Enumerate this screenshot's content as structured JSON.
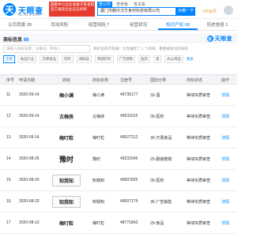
{
  "header": {
    "logo_mark": "天",
    "logo_text": "天眼查",
    "logo_url": "TianYanCha.com",
    "promo": [
      "国家中小企业发展子基金旗下",
      "官方备案企业征信机构"
    ],
    "search_tabs": [
      {
        "label": "查公司",
        "active": true
      },
      {
        "label": "查老板",
        "active": false
      },
      {
        "label": "查关系",
        "active": false
      }
    ],
    "search_value": "厦门市鹏仔汉方食材科技有限公司",
    "search_button": "天眼一下",
    "vip_label": "VIP会员"
  },
  "nav": [
    {
      "label": "公司背景",
      "count": "28",
      "active": false
    },
    {
      "label": "司法风险",
      "count": "",
      "active": false
    },
    {
      "label": "经营风险",
      "count": "7",
      "active": false
    },
    {
      "label": "经营状况",
      "count": "",
      "active": false
    },
    {
      "label": "知识产权",
      "count": "68",
      "active": true
    },
    {
      "label": "历史信息",
      "count": "1",
      "active": false
    }
  ],
  "section": {
    "title": "商标信息",
    "count": "68",
    "watermark": "天眼查"
  },
  "filter": {
    "placeholder": "请输入商标名称、注册号、申请人",
    "hint": "保护品牌不再难！为你推荐了 1 个商标，看看被抢注的商标"
  },
  "chips": [
    {
      "label": "全部",
      "active": true
    },
    {
      "label": "食品行业",
      "active": false
    },
    {
      "label": "方便食品",
      "active": false
    },
    {
      "label": "饮料",
      "active": false
    },
    {
      "label": "调味品",
      "active": false
    },
    {
      "label": "啤酒饮料",
      "active": false
    },
    {
      "label": "广告销售",
      "active": false
    },
    {
      "label": "医药",
      "active": false
    },
    {
      "label": "酒",
      "active": false
    },
    {
      "label": "办公用品",
      "active": false
    }
  ],
  "chip_link": "更多",
  "table": {
    "headers": [
      "序号",
      "申请日期",
      "商标",
      "商标名称",
      "注册号",
      "国际分类",
      "商标状态",
      "操作"
    ],
    "rows": [
      {
        "idx": "11",
        "date": "2020-09-14",
        "mark": "梅小满",
        "name": "梅小满",
        "reg": "49735177",
        "cls": "33-酒",
        "status": "等待实质审查",
        "op": "详情",
        "style": "plain"
      },
      {
        "idx": "12",
        "date": "2020-09-14",
        "mark": "古梅侠",
        "name": "古梅侠",
        "reg": "49633315",
        "cls": "05-医药",
        "status": "等待实质审查",
        "op": "详情",
        "style": "plain"
      },
      {
        "idx": "13",
        "date": "2020-09-14",
        "mark": "梅叮粒",
        "name": "梅叮粒",
        "reg": "49527212",
        "cls": "30-方便食品",
        "status": "等待实质审查",
        "op": "详情",
        "style": "plain"
      },
      {
        "idx": "14",
        "date": "2020-08-26",
        "mark": "豫时",
        "name": "豫时",
        "reg": "49231545",
        "cls": "25-服装鞋帽",
        "status": "等待实质审查",
        "op": "详情",
        "style": "big"
      },
      {
        "idx": "15",
        "date": "2020-08-20",
        "mark": "知我知",
        "name": "知我知",
        "reg": "49007835",
        "cls": "05-医药",
        "status": "等待实质审查",
        "op": "详情",
        "style": "boxed"
      },
      {
        "idx": "16",
        "date": "2020-08-20",
        "mark": "知我知",
        "name": "知我知",
        "reg": "49007179",
        "cls": "35-广告销售",
        "status": "等待实质审查",
        "op": "详情",
        "style": "boxed"
      },
      {
        "idx": "17",
        "date": "2020-08-13",
        "mark": "梅叮粒",
        "name": "梅叮粒",
        "reg": "48771842",
        "cls": "29-食品",
        "status": "等待实质审查",
        "op": "详情",
        "style": "plain"
      }
    ]
  },
  "colors": {
    "brand": "#0084ff",
    "promo": "#e63b2e",
    "vip": "#e8a03c"
  }
}
